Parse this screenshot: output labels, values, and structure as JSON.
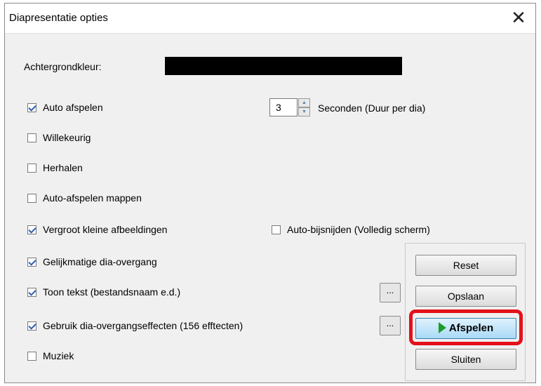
{
  "window": {
    "title": "Diapresentatie opties",
    "close_glyph": "✕"
  },
  "background": {
    "label": "Achtergrondkleur:",
    "color": "#000000"
  },
  "spinner": {
    "value": "3",
    "unit_label": "Seconden (Duur per dia)",
    "up_glyph": "▲",
    "down_glyph": "▼"
  },
  "options": [
    {
      "label": "Auto afspelen",
      "checked": true
    },
    {
      "label": "Willekeurig",
      "checked": false
    },
    {
      "label": "Herhalen",
      "checked": false
    },
    {
      "label": "Auto-afspelen mappen",
      "checked": false
    },
    {
      "label": "Vergroot kleine afbeeldingen",
      "checked": true
    },
    {
      "label": "Gelijkmatige dia-overgang",
      "checked": true
    },
    {
      "label": "Toon tekst (bestandsnaam e.d.)",
      "checked": true
    },
    {
      "label": "Gebruik dia-overgangseffecten (156 efftecten)",
      "checked": true
    },
    {
      "label": "Muziek",
      "checked": false
    }
  ],
  "autocrop": {
    "label": "Auto-bijsnijden (Volledig scherm)",
    "checked": false
  },
  "ellipsis_label": "...",
  "buttons": {
    "reset": "Reset",
    "save": "Opslaan",
    "play": "Afspelen",
    "close": "Sluiten"
  },
  "colors": {
    "highlight": "#e4101a",
    "play_icon": "#1e9c2a",
    "checkmark": "#2b5fb3"
  }
}
